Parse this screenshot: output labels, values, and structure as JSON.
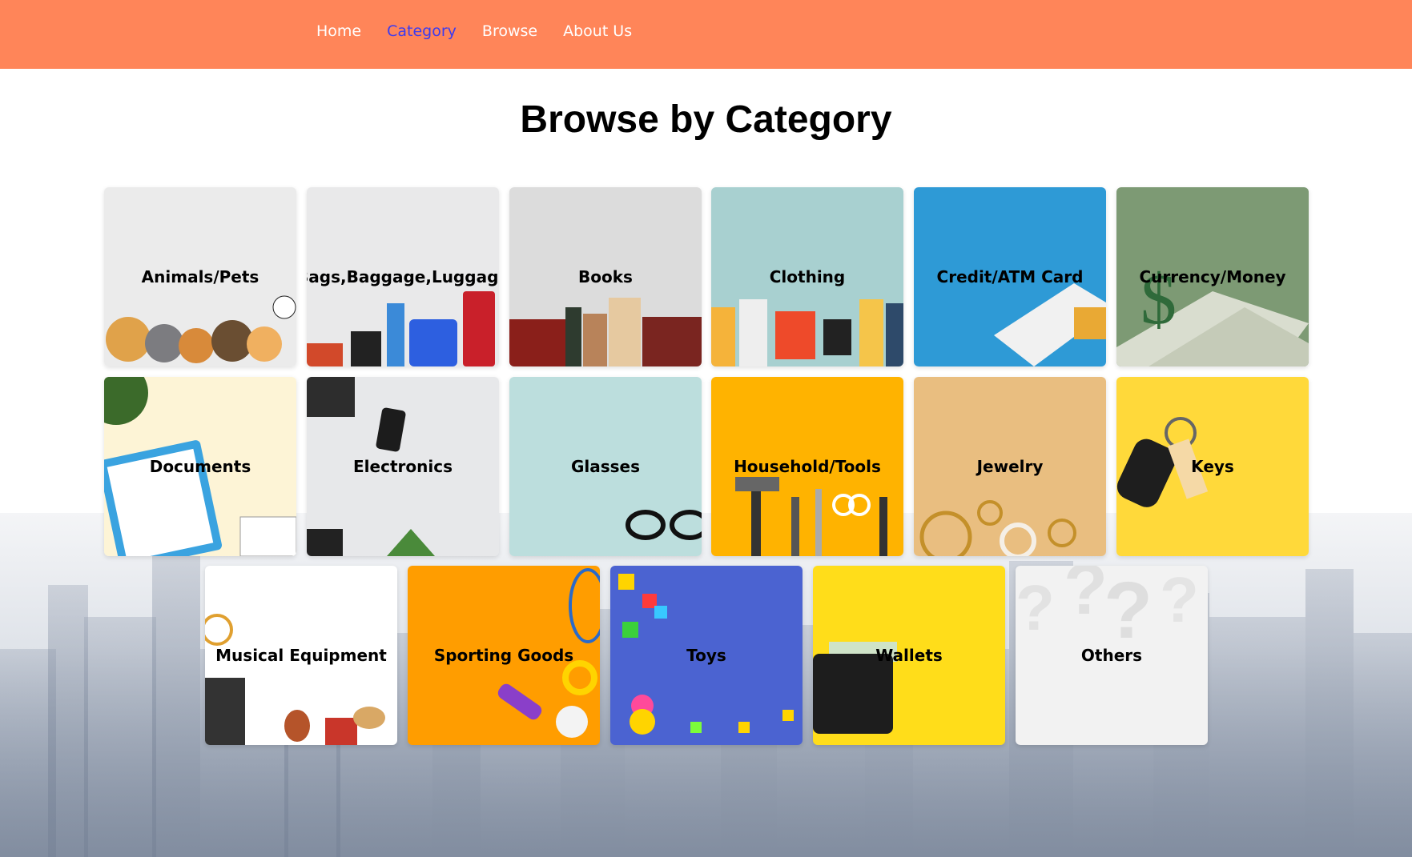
{
  "nav": {
    "items": [
      {
        "label": "Home",
        "active": false
      },
      {
        "label": "Category",
        "active": true
      },
      {
        "label": "Browse",
        "active": false
      },
      {
        "label": "About Us",
        "active": false
      }
    ]
  },
  "page": {
    "title": "Browse by Category"
  },
  "categories": [
    {
      "label": "Animals/Pets",
      "color": "#ebebeb"
    },
    {
      "label": "Bags,Baggage,Luggage",
      "color": "#e9e9ea"
    },
    {
      "label": "Books",
      "color": "#dcdcdc"
    },
    {
      "label": "Clothing",
      "color": "#a8d0d0"
    },
    {
      "label": "Credit/ATM Card",
      "color": "#2e9ad6"
    },
    {
      "label": "Currency/Money",
      "color": "#7d9a74"
    },
    {
      "label": "Documents",
      "color": "#fdf4d6"
    },
    {
      "label": "Electronics",
      "color": "#e7e8ea"
    },
    {
      "label": "Glasses",
      "color": "#bcdedd"
    },
    {
      "label": "Household/Tools",
      "color": "#ffb300"
    },
    {
      "label": "Jewelry",
      "color": "#e9be80"
    },
    {
      "label": "Keys",
      "color": "#ffd93a"
    },
    {
      "label": "Musical Equipment",
      "color": "#ffffff"
    },
    {
      "label": "Sporting Goods",
      "color": "#ff9d00"
    },
    {
      "label": "Toys",
      "color": "#4b63d1"
    },
    {
      "label": "Wallets",
      "color": "#ffdd1a"
    },
    {
      "label": "Others",
      "color": "#f2f2f2"
    }
  ]
}
